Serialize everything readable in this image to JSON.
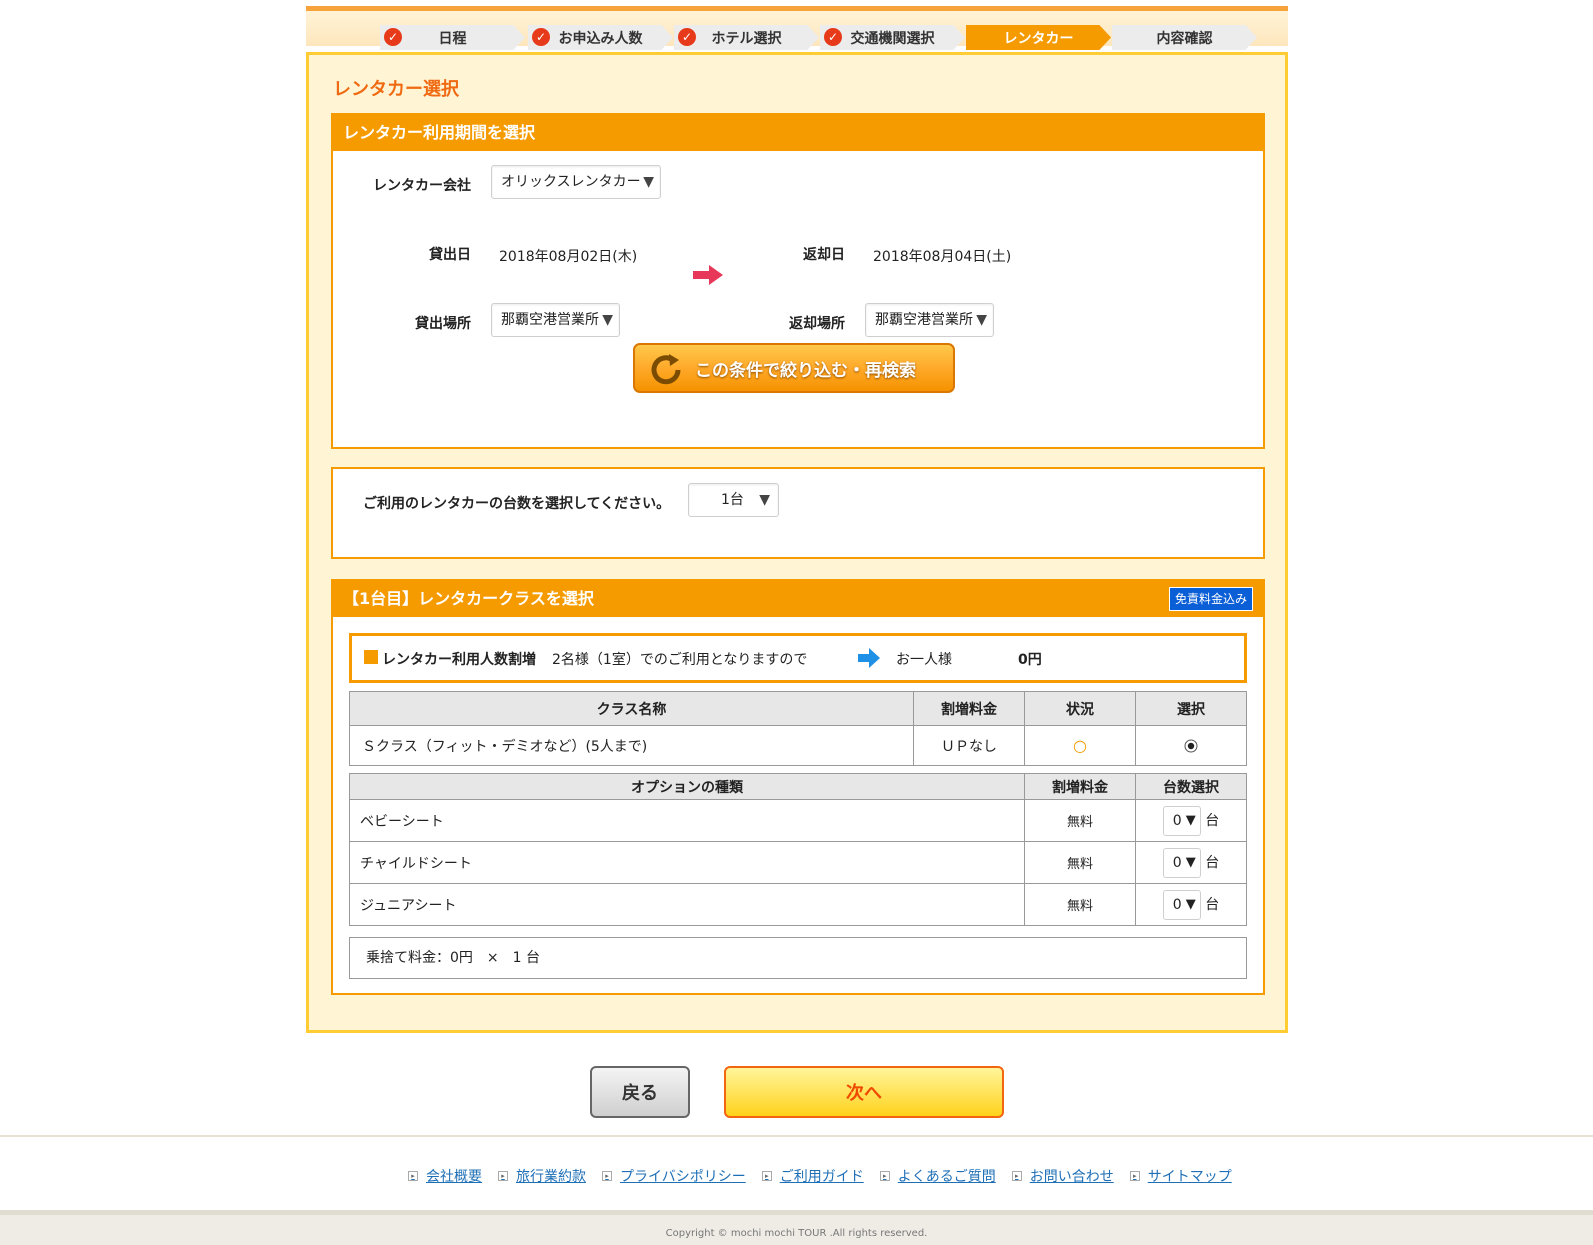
{
  "steps": [
    {
      "label": "日程",
      "done": true
    },
    {
      "label": "お申込み人数",
      "done": true
    },
    {
      "label": "ホテル選択",
      "done": true
    },
    {
      "label": "交通機関選択",
      "done": true
    },
    {
      "label": "レンタカー",
      "done": false,
      "active": true
    },
    {
      "label": "内容確認",
      "done": false
    }
  ],
  "page_title": "レンタカー選択",
  "period_section": {
    "title": "レンタカー利用期間を選択",
    "company_label": "レンタカー会社",
    "company_value": "オリックスレンタカー",
    "pickup_date_label": "貸出日",
    "pickup_date": "2018年08月02日(木)",
    "return_date_label": "返却日",
    "return_date": "2018年08月04日(土)",
    "pickup_place_label": "貸出場所",
    "pickup_place": "那覇空港営業所",
    "return_place_label": "返却場所",
    "return_place": "那覇空港営業所",
    "search_button": "この条件で絞り込む・再検索"
  },
  "count_section": {
    "prompt": "ご利用のレンタカーの台数を選択してください。",
    "value": "1台"
  },
  "class_section": {
    "title": "【1台目】レンタカークラスを選択",
    "badge": "免責料金込み",
    "notice_label": "レンタカー利用人数割増",
    "notice_text": "2名様（1室）でのご利用となりますので",
    "notice_per": "お一人様",
    "notice_amount": "0円",
    "class_headers": [
      "クラス名称",
      "割増料金",
      "状況",
      "選択"
    ],
    "class_rows": [
      {
        "name": "Ｓクラス（フィット・デミオなど）(5人まで)",
        "surcharge": "ＵＰなし",
        "status": "○"
      }
    ],
    "option_headers": [
      "オプションの種類",
      "割増料金",
      "台数選択"
    ],
    "option_rows": [
      {
        "name": "ベビーシート",
        "price": "無料",
        "qty": "0",
        "unit": "台"
      },
      {
        "name": "チャイルドシート",
        "price": "無料",
        "qty": "0",
        "unit": "台"
      },
      {
        "name": "ジュニアシート",
        "price": "無料",
        "qty": "0",
        "unit": "台"
      }
    ],
    "dropoff_text": "乗捨て料金：0円　×　1 台"
  },
  "buttons": {
    "back": "戻る",
    "next": "次へ"
  },
  "footer": {
    "links": [
      "会社概要",
      "旅行業約款",
      "プライバシポリシー",
      "ご利用ガイド",
      "よくあるご質問",
      "お問い合わせ",
      "サイトマップ"
    ],
    "copyright": "Copyright © mochi mochi TOUR .All rights reserved."
  },
  "colors": {
    "accent": "#f59b00",
    "panel_bg": "#fff5d4",
    "title": "#ef6a12",
    "badge": "#0a5fd6"
  }
}
